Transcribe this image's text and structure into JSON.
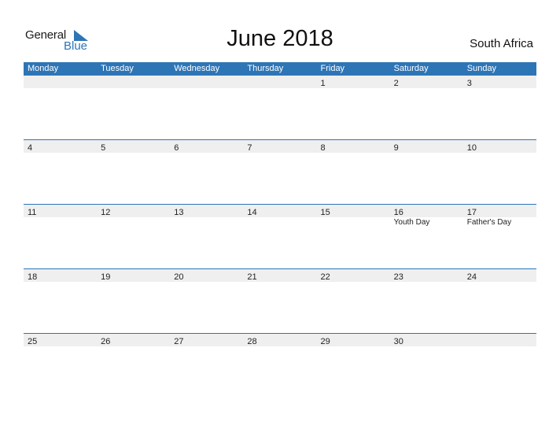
{
  "logo": {
    "line1": "General",
    "line2": "Blue"
  },
  "title": "June 2018",
  "country": "South Africa",
  "colors": {
    "accent": "#2e75b6",
    "strip": "#efefef"
  },
  "weekdays": [
    "Monday",
    "Tuesday",
    "Wednesday",
    "Thursday",
    "Friday",
    "Saturday",
    "Sunday"
  ],
  "weeks": [
    {
      "days": [
        "",
        "",
        "",
        "",
        "1",
        "2",
        "3"
      ],
      "events": [
        "",
        "",
        "",
        "",
        "",
        "",
        ""
      ]
    },
    {
      "days": [
        "4",
        "5",
        "6",
        "7",
        "8",
        "9",
        "10"
      ],
      "events": [
        "",
        "",
        "",
        "",
        "",
        "",
        ""
      ]
    },
    {
      "days": [
        "11",
        "12",
        "13",
        "14",
        "15",
        "16",
        "17"
      ],
      "events": [
        "",
        "",
        "",
        "",
        "",
        "Youth Day",
        "Father's Day"
      ]
    },
    {
      "days": [
        "18",
        "19",
        "20",
        "21",
        "22",
        "23",
        "24"
      ],
      "events": [
        "",
        "",
        "",
        "",
        "",
        "",
        ""
      ]
    },
    {
      "days": [
        "25",
        "26",
        "27",
        "28",
        "29",
        "30",
        ""
      ],
      "events": [
        "",
        "",
        "",
        "",
        "",
        "",
        ""
      ]
    }
  ]
}
